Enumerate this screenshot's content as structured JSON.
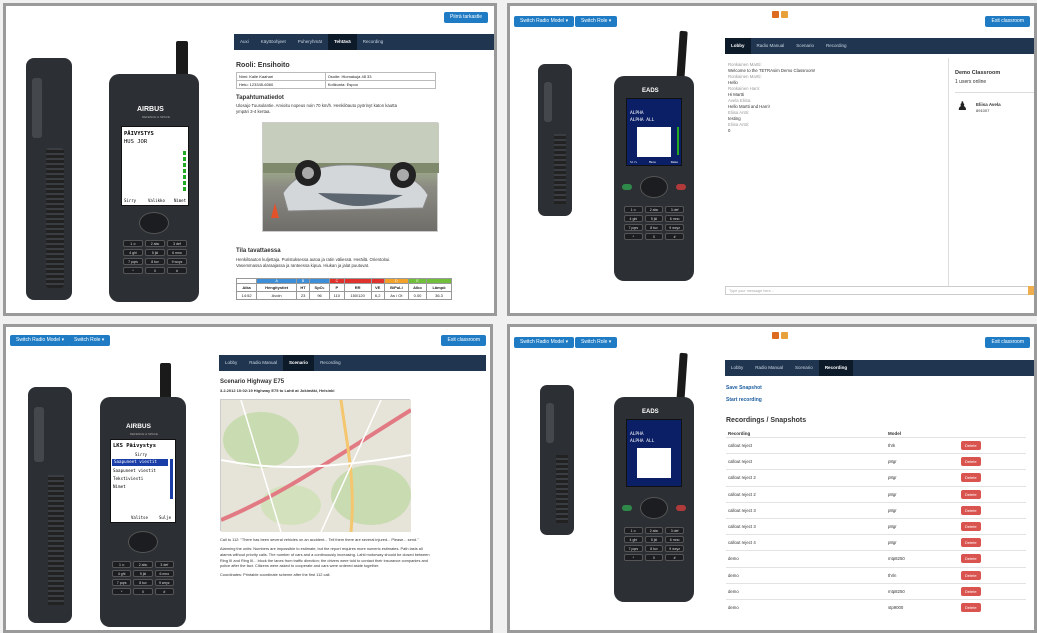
{
  "p1": {
    "top_button": "Piirrä tarkastle",
    "tabs": [
      "Auxi",
      "Käyttöohjeet",
      "Puheryhmät",
      "Tehtävä",
      "Recording"
    ],
    "active_tab": 3,
    "radio_brand": "AIRBUS",
    "radio_sub": "DEFENCE & SPACE",
    "screen_lines": [
      "PÄIVYSTYS",
      "HUS JOR"
    ],
    "screen_soft": [
      "Sirry",
      "Valikko",
      "Nimet"
    ],
    "role_title": "Rooli: Ensihoito",
    "info": [
      [
        "Nimi: Kalle Kaahari",
        "Osoite: Hiomakuja 48 33"
      ],
      [
        "Hetu: 123345-6060",
        "Kotikunta: Espoo"
      ]
    ],
    "incident_title": "Tapahtumatiedot",
    "incident_text": [
      "Ulosajo Tuusulantie. Arvioitu nopeus noin 70 km/h. Henkilöauto pyörinyt katon kautta",
      "ympäri 3-4 kertaa."
    ],
    "state_title": "Tila tavattaessa",
    "state_text": [
      "Henkilöauton kuljettaja. Puristuksessa autoa ja ratin väliessä. Heräilä. Orientoitui.",
      "Vasemmassa alaraajassa ja ranteessa kipua. Hiukan ja jalat puutuvat."
    ],
    "vitals_headers": [
      "Aika",
      "Hengitystiet",
      "HT",
      "SpO₂",
      "P",
      "RR",
      "VE",
      "B/PuLi",
      "Alko",
      "Lämpö"
    ],
    "vitals_letters": [
      "",
      "A",
      "B",
      "",
      "C",
      "",
      "",
      "D",
      "E",
      ""
    ],
    "vitals_row": [
      "14:52",
      "Avoin",
      "23",
      "96",
      "110",
      "150/120",
      "6,2",
      "As / Ot",
      "0.00",
      "36.3"
    ]
  },
  "p2": {
    "buttons": [
      "Switch Radio Model ▾",
      "Switch Role ▾"
    ],
    "exit": "Exit classroom",
    "tabs": [
      "Lobby",
      "Radio Manual",
      "Scenario",
      "Recording"
    ],
    "active_tab": 0,
    "radio_brand": "EADS",
    "screen_lines": [
      "ALPHA",
      "ALPHA ALL"
    ],
    "screen_soft": [
      "Sirv",
      "Menu",
      "Name"
    ],
    "chat": [
      [
        "Ronkainen Martti:",
        "Welcome to the TETRAsim Demo Classroom!"
      ],
      [
        "Ronkainen Martti:",
        "Hello"
      ],
      [
        "Ronkainen Harri:",
        "Hi Martti"
      ],
      [
        "Avela Eliisa:",
        "Hello Martti and Harri!"
      ],
      [
        "Eliisa Antti:",
        "testing"
      ],
      [
        "Eliisa Antti:",
        "0"
      ]
    ],
    "message_placeholder": "Type your message here...",
    "classroom_title": "Demo Classroom",
    "online": "1 users online",
    "user_name": "Eliisa Avela",
    "user_id": "891007"
  },
  "p3": {
    "buttons": [
      "Switch Radio Model ▾",
      "Switch Role ▾"
    ],
    "exit": "Exit classroom",
    "tabs": [
      "Lobby",
      "Radio Manual",
      "Scenario",
      "Recording"
    ],
    "active_tab": 2,
    "radio_brand": "AIRBUS",
    "radio_sub": "DEFENCE & SPACE",
    "screen_lines": [
      "LKS Päivystys",
      "Sirry",
      "Saapuneet viestit",
      "Saapuneet viestit",
      "Tekstiviesti",
      "Nimet"
    ],
    "screen_soft": [
      "Valitse",
      "Sulje"
    ],
    "scenario_title": "Scenario Highway E75",
    "scenario_sub": "3.2.2012 10:02:19 Highway E75 to Lahti at Jokimäki, Helsinki",
    "paragraphs": [
      "Call to 112: \"There has been several vehicles on an accident... Tell them there are several injured... Please... send.\"",
      "Alarming the units: Numbers are impossible to estimate, but the report requires more numeric estimates. Path lasts all alarms without priority calls. The number of cars and a continuously increasing. Lahti motorway should be closed between Ring III and Ring III... block the lanes from traffic direction; the drivers were told to contact their insurance companies and police after the fact. Citizens were asked to cooperate and cars were ordered aside together.",
      "Coordinates: Printable coordinate scheme after the first 112 call."
    ]
  },
  "p4": {
    "buttons": [
      "Switch Radio Model ▾",
      "Switch Role ▾"
    ],
    "exit": "Exit classroom",
    "tabs": [
      "Lobby",
      "Radio Manual",
      "Scenario",
      "Recording"
    ],
    "active_tab": 3,
    "radio_brand": "EADS",
    "screen_lines": [
      "ALPHA",
      "ALPHA ALL"
    ],
    "save_snapshot": "Save Snapshot",
    "start_recording": "Start recording",
    "rec_title": "Recordings / Snapshots",
    "col_recording": "Recording",
    "col_model": "Model",
    "delete_label": "Delete",
    "rows": [
      [
        "callout reject",
        "thrk"
      ],
      [
        "callout reject",
        "p8gr"
      ],
      [
        "callout reject 2",
        "p8gr"
      ],
      [
        "callout reject 2",
        "p8gr"
      ],
      [
        "callout reject 3",
        "p8gr"
      ],
      [
        "callout reject 3",
        "p8gr"
      ],
      [
        "callout reject 4",
        "p8gr"
      ],
      [
        "demo",
        "mtp8250"
      ],
      [
        "demo",
        "thrln"
      ],
      [
        "demo",
        "mtp8250"
      ],
      [
        "demo",
        "stp9000"
      ]
    ]
  },
  "colors": {
    "accent": "#1f7cc4",
    "navbar": "#1f3550",
    "delete": "#d9534f",
    "online": "#2bb34a"
  }
}
